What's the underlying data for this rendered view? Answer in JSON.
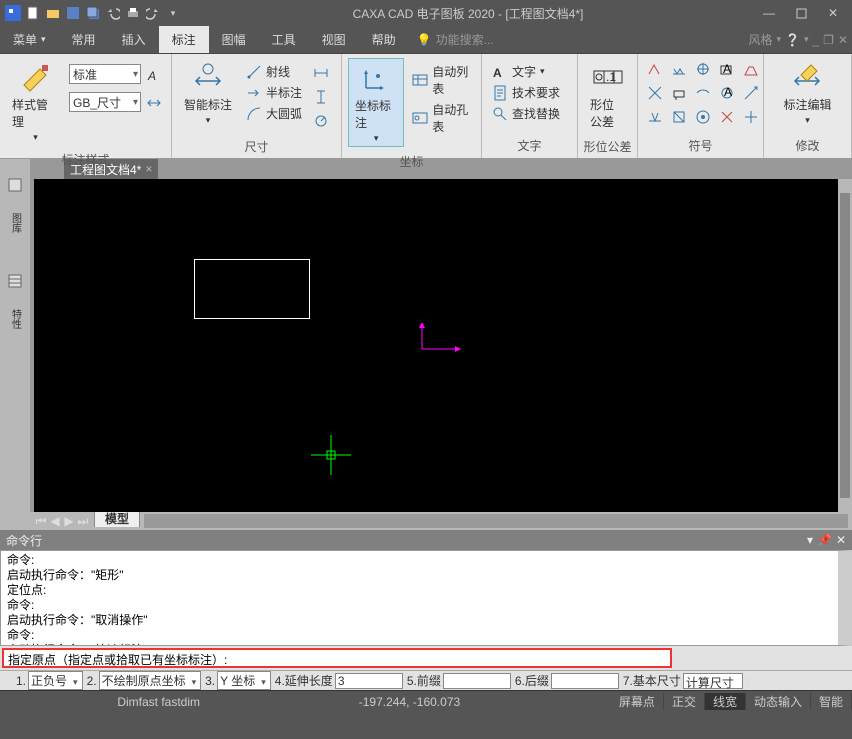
{
  "title": "CAXA CAD 电子图板 2020 - [工程图文档4*]",
  "menus": [
    "菜单",
    "常用",
    "插入",
    "标注",
    "图幅",
    "工具",
    "视图",
    "帮助"
  ],
  "activeMenu": "标注",
  "search_placeholder": "功能搜索...",
  "style_label": "风格",
  "ribbon": {
    "g1": {
      "label": "标注样式",
      "big": "样式管理",
      "dd1": "标准",
      "dd2": "GB_尺寸"
    },
    "g2": {
      "label": "尺寸",
      "big": "智能标注",
      "items": [
        "射线",
        "半标注",
        "大圆弧"
      ]
    },
    "g3": {
      "label": "坐标",
      "big": "坐标标注",
      "items": [
        "自动列表",
        "自动孔表"
      ]
    },
    "g4": {
      "label": "文字",
      "big": "文字",
      "items": [
        "技术要求",
        "查找替换"
      ]
    },
    "g5": {
      "label": "形位公差",
      "big": "形位公差"
    },
    "g6": {
      "label": "符号"
    },
    "g7": {
      "label": "修改",
      "big": "标注编辑"
    }
  },
  "doc_tab": "工程图文档4*",
  "model_tab": "模型",
  "cmd_title": "命令行",
  "cmd_history": [
    "命令:",
    "启动执行命令：\"矩形\"",
    "定位点:",
    "命令:",
    "启动执行命令：\"取消操作\"",
    "命令:",
    "启动执行命令：\"快速标注\""
  ],
  "cmd_input": "指定原点（指定点或拾取已有坐标标注）:",
  "opts": {
    "o1": {
      "n": "1.",
      "v": "正负号"
    },
    "o2": {
      "n": "2.",
      "v": "不绘制原点坐标"
    },
    "o3": {
      "n": "3.",
      "v": "Y 坐标"
    },
    "o4": {
      "n": "4.延伸长度",
      "v": "3"
    },
    "o5": {
      "n": "5.前缀",
      "v": ""
    },
    "o6": {
      "n": "6.后缀",
      "v": ""
    },
    "o7": {
      "n": "7.基本尺寸",
      "v": "计算尺寸"
    }
  },
  "status": {
    "cmd": "Dimfast fastdim",
    "coord": "-197.244, -160.073",
    "cells": [
      "屏幕点",
      "正交",
      "线宽",
      "动态输入",
      "智能"
    ],
    "on": "线宽"
  }
}
